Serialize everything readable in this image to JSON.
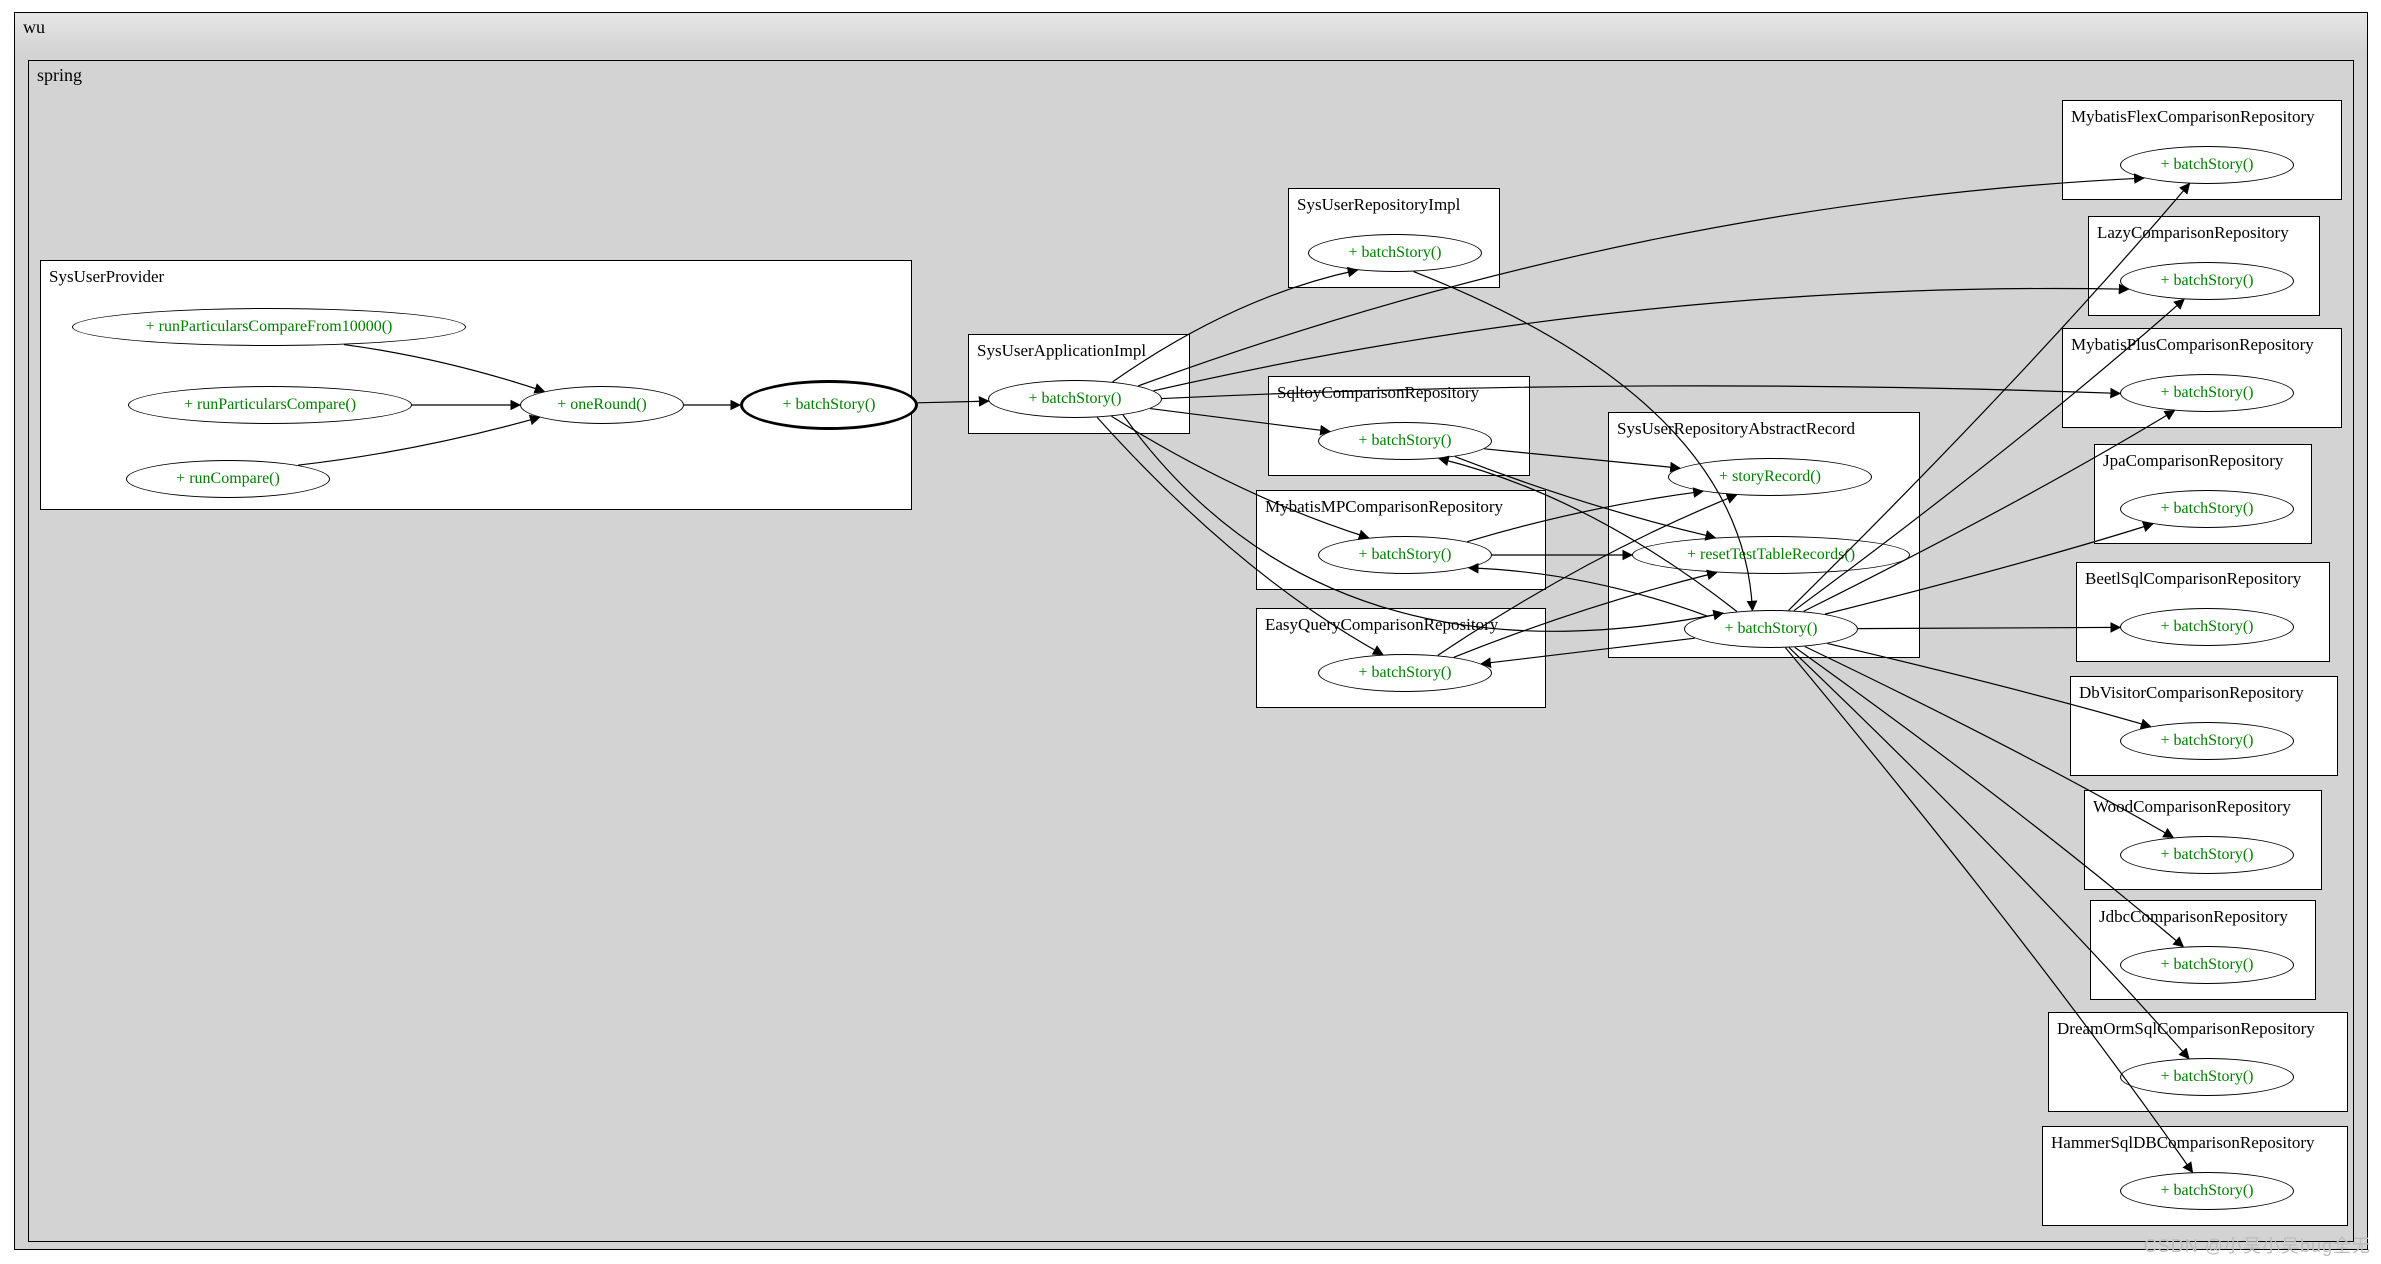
{
  "outer": {
    "label": "wu"
  },
  "inner": {
    "label": "spring"
  },
  "classes": {
    "SysUserProvider": {
      "title": "SysUserProvider",
      "methods": {
        "runParticularsCompareFrom10000": "+ runParticularsCompareFrom10000()",
        "runParticularsCompare": "+ runParticularsCompare()",
        "runCompare": "+ runCompare()",
        "oneRound": "+ oneRound()",
        "batchStory": "+ batchStory()"
      }
    },
    "SysUserApplicationImpl": {
      "title": "SysUserApplicationImpl",
      "methods": {
        "batchStory": "+ batchStory()"
      }
    },
    "SysUserRepositoryImpl": {
      "title": "SysUserRepositoryImpl",
      "methods": {
        "batchStory": "+ batchStory()"
      }
    },
    "SqltoyComparisonRepository": {
      "title": "SqltoyComparisonRepository",
      "methods": {
        "batchStory": "+ batchStory()"
      }
    },
    "MybatisMPComparisonRepository": {
      "title": "MybatisMPComparisonRepository",
      "methods": {
        "batchStory": "+ batchStory()"
      }
    },
    "EasyQueryComparisonRepository": {
      "title": "EasyQueryComparisonRepository",
      "methods": {
        "batchStory": "+ batchStory()"
      }
    },
    "SysUserRepositoryAbstractRecord": {
      "title": "SysUserRepositoryAbstractRecord",
      "methods": {
        "storyRecord": "+ storyRecord()",
        "resetTestTableRecords": "+ resetTestTableRecords()",
        "batchStory": "+ batchStory()"
      }
    },
    "MybatisFlexComparisonRepository": {
      "title": "MybatisFlexComparisonRepository",
      "methods": {
        "batchStory": "+ batchStory()"
      }
    },
    "LazyComparisonRepository": {
      "title": "LazyComparisonRepository",
      "methods": {
        "batchStory": "+ batchStory()"
      }
    },
    "MybatisPlusComparisonRepository": {
      "title": "MybatisPlusComparisonRepository",
      "methods": {
        "batchStory": "+ batchStory()"
      }
    },
    "JpaComparisonRepository": {
      "title": "JpaComparisonRepository",
      "methods": {
        "batchStory": "+ batchStory()"
      }
    },
    "BeetlSqlComparisonRepository": {
      "title": "BeetlSqlComparisonRepository",
      "methods": {
        "batchStory": "+ batchStory()"
      }
    },
    "DbVisitorComparisonRepository": {
      "title": "DbVisitorComparisonRepository",
      "methods": {
        "batchStory": "+ batchStory()"
      }
    },
    "WoodComparisonRepository": {
      "title": "WoodComparisonRepository",
      "methods": {
        "batchStory": "+ batchStory()"
      }
    },
    "JdbcComparisonRepository": {
      "title": "JdbcComparisonRepository",
      "methods": {
        "batchStory": "+ batchStory()"
      }
    },
    "DreamOrmSqlComparisonRepository": {
      "title": "DreamOrmSqlComparisonRepository",
      "methods": {
        "batchStory": "+ batchStory()"
      }
    },
    "HammerSqlDBComparisonRepository": {
      "title": "HammerSqlDBComparisonRepository",
      "methods": {
        "batchStory": "+ batchStory()"
      }
    }
  },
  "watermark": "CSDN @小吴小吴bug全无"
}
